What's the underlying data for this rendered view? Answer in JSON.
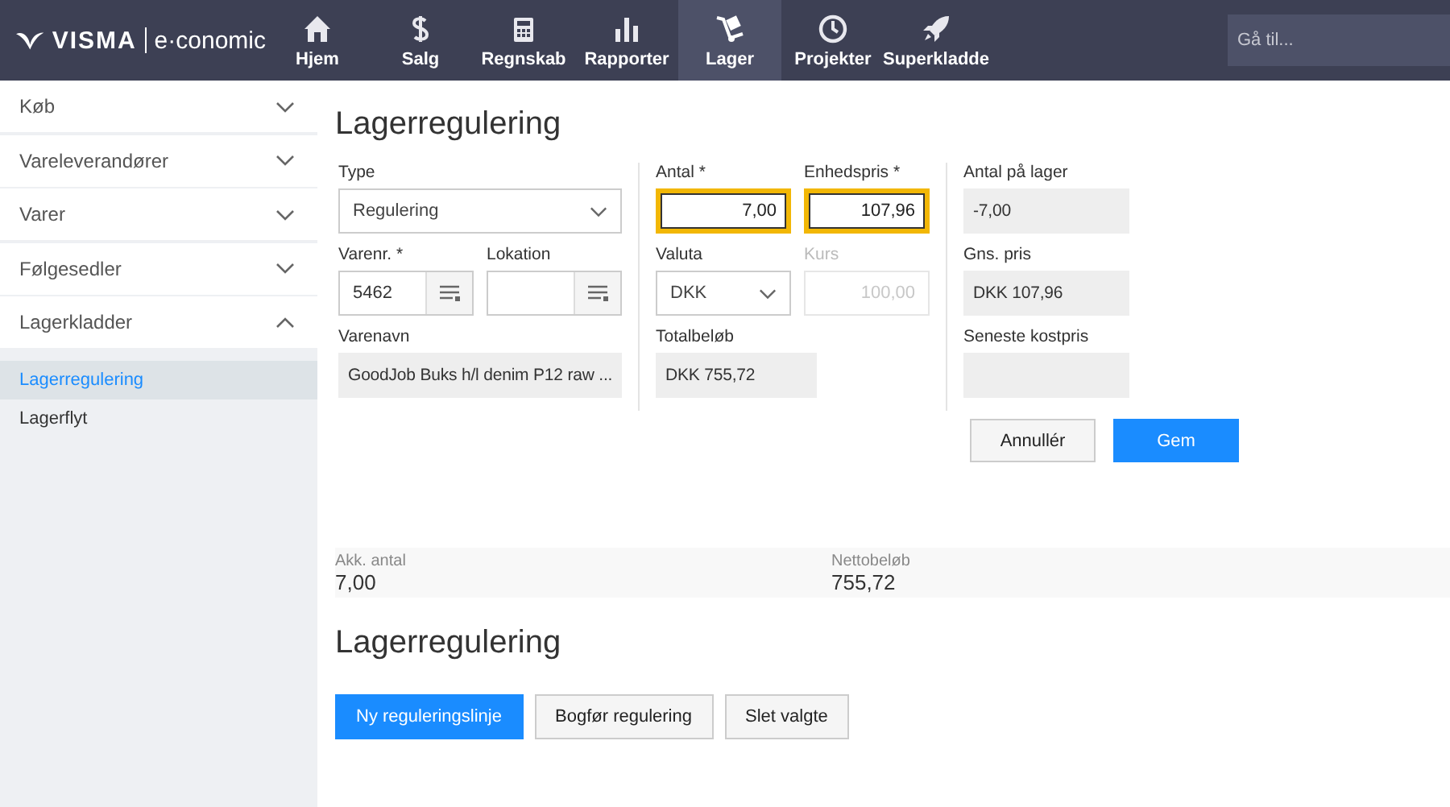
{
  "brand": {
    "name": "VISMA",
    "product": "e·conomic"
  },
  "nav": [
    {
      "label": "Hjem",
      "kind": "home",
      "selected": false
    },
    {
      "label": "Salg",
      "kind": "dollar",
      "selected": false
    },
    {
      "label": "Regnskab",
      "kind": "calculator",
      "selected": false
    },
    {
      "label": "Rapporter",
      "kind": "chart",
      "selected": false
    },
    {
      "label": "Lager",
      "kind": "dolly",
      "selected": true
    },
    {
      "label": "Projekter",
      "kind": "clock",
      "selected": false
    },
    {
      "label": "Superkladde",
      "kind": "rocket",
      "selected": false
    }
  ],
  "search": {
    "placeholder": "Gå til..."
  },
  "sidebar": {
    "items": [
      {
        "label": "Køb",
        "expanded": false
      },
      {
        "label": "Vareleverandører",
        "expanded": false
      },
      {
        "label": "Varer",
        "expanded": false
      },
      {
        "label": "Følgesedler",
        "expanded": false
      },
      {
        "label": "Lagerkladder",
        "expanded": true,
        "children": [
          {
            "label": "Lagerregulering",
            "selected": true
          },
          {
            "label": "Lagerflyt",
            "selected": false
          }
        ]
      }
    ]
  },
  "page_title": "Lagerregulering",
  "form": {
    "columns": [
      [
        [
          {
            "label": "Type",
            "kind": "select",
            "value": "Regulering"
          }
        ],
        [
          {
            "label": "Varenr. *",
            "kind": "lookup",
            "value": "5462"
          },
          {
            "label": "Lokation",
            "kind": "lookup"
          }
        ],
        [
          {
            "label": "Varenavn",
            "kind": "readonly",
            "value": "GoodJob Buks h/l denim P12 raw ..."
          }
        ]
      ],
      [
        [
          {
            "label": "Antal *",
            "kind": "input",
            "value": "7,00",
            "highlighted": true,
            "disabled": false
          },
          {
            "label": "Enhedspris *",
            "kind": "input",
            "value": "107,96",
            "highlighted": true,
            "disabled": false
          }
        ],
        [
          {
            "label": "Valuta",
            "kind": "select",
            "value": "DKK"
          },
          {
            "label": "Kurs",
            "kind": "input",
            "value": "100,00",
            "highlighted": false,
            "disabled": true
          }
        ],
        [
          {
            "label": "Totalbeløb",
            "kind": "readonly",
            "value": "DKK 755,72"
          }
        ]
      ],
      [
        [
          {
            "label": "Antal på lager",
            "kind": "readonly",
            "value": "-7,00"
          }
        ],
        [
          {
            "label": "Gns. pris",
            "kind": "readonly",
            "value": "DKK 107,96"
          }
        ],
        [
          {
            "label": "Seneste kostpris",
            "kind": "readonly"
          }
        ]
      ]
    ],
    "actions": [
      {
        "label": "Annullér",
        "kind": "secondary"
      },
      {
        "label": "Gem",
        "kind": "primary"
      }
    ]
  },
  "totals": [
    {
      "label": "Akk. antal",
      "value": "7,00"
    },
    {
      "label": "Nettobeløb",
      "value": "755,72"
    }
  ],
  "section_title": "Lagerregulering",
  "list_actions": [
    {
      "label": "Ny reguleringslinje",
      "kind": "primary"
    },
    {
      "label": "Bogfør regulering",
      "kind": "secondary"
    },
    {
      "label": "Slet valgte",
      "kind": "secondary"
    }
  ]
}
